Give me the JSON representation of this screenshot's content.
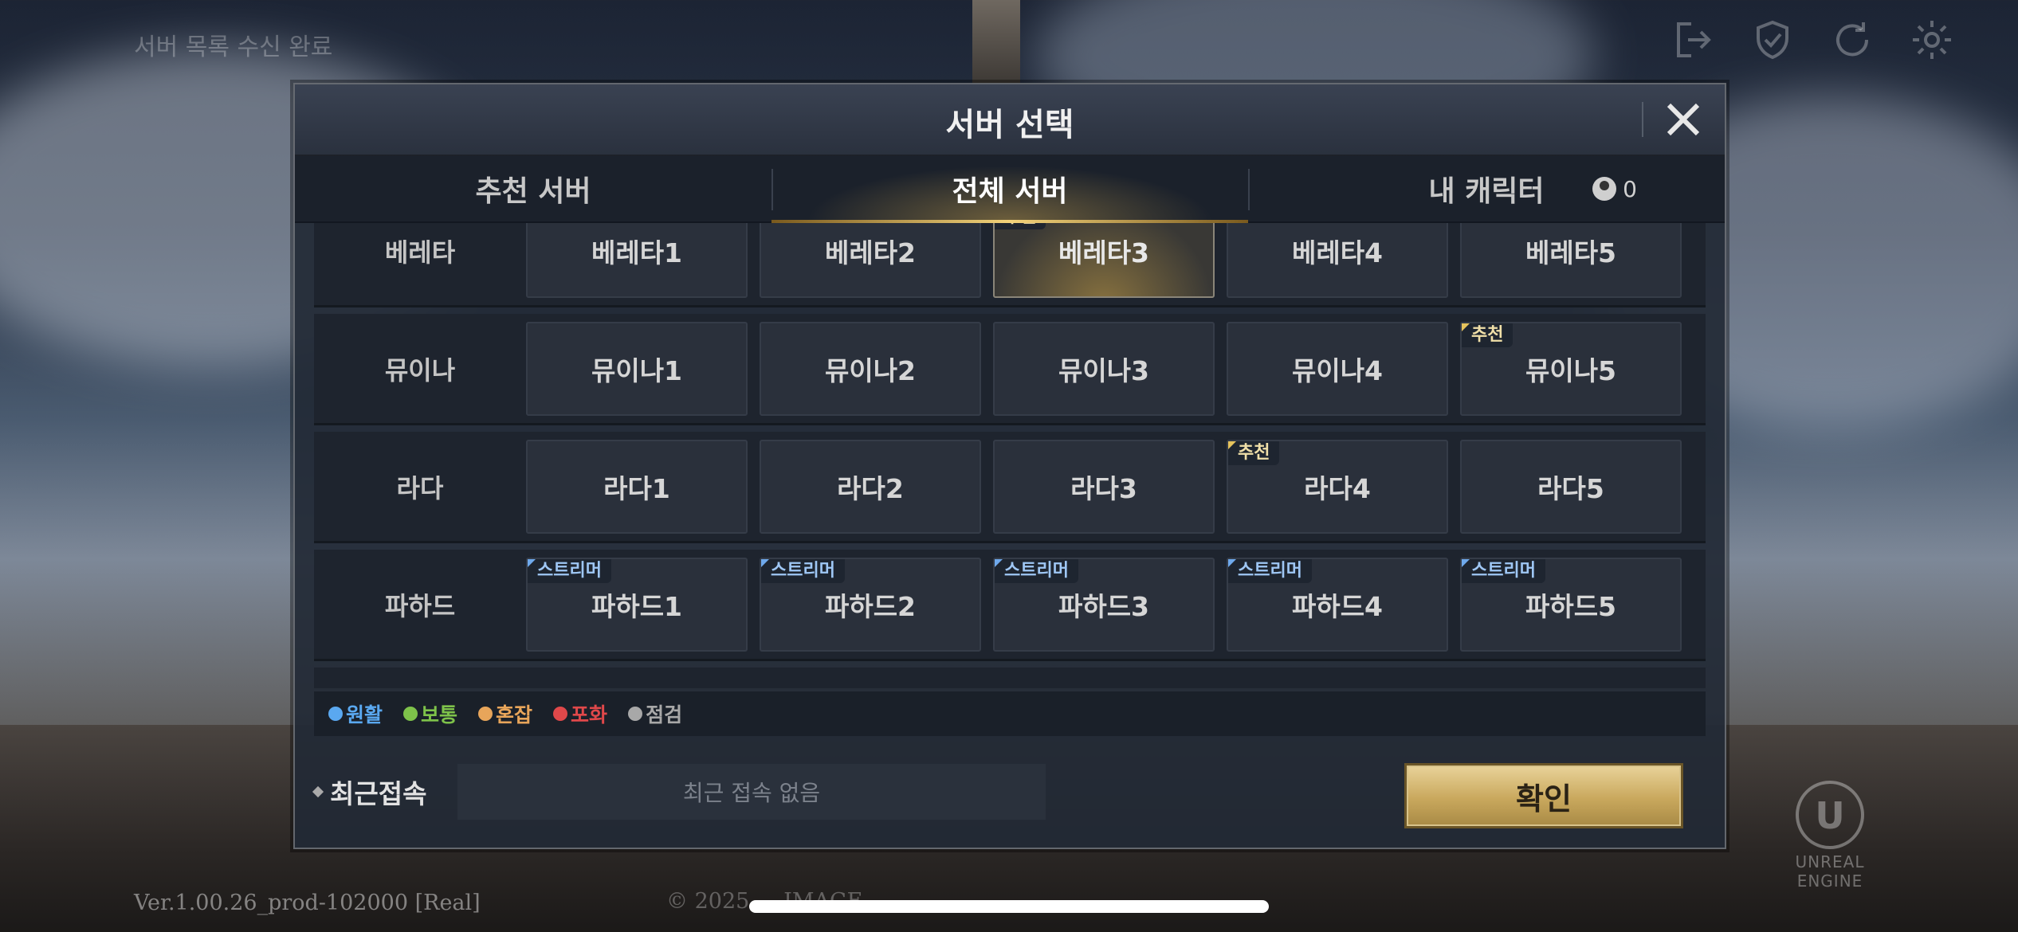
{
  "status_text": "서버 목록 수신 완료",
  "top_icons": [
    "logout-icon",
    "shield-check-icon",
    "refresh-icon",
    "settings-gear-icon"
  ],
  "modal": {
    "title": "서버 선택",
    "tabs": [
      {
        "label": "추천 서버",
        "active": false
      },
      {
        "label": "전체 서버",
        "active": true
      },
      {
        "label": "내 캐릭터",
        "active": false,
        "count": "0"
      }
    ]
  },
  "server_rows": [
    {
      "group": "베레타",
      "servers": [
        {
          "name": "베레타1",
          "badge": ""
        },
        {
          "name": "베레타2",
          "badge": ""
        },
        {
          "name": "베레타3",
          "badge": "추천",
          "selected": true
        },
        {
          "name": "베레타4",
          "badge": ""
        },
        {
          "name": "베레타5",
          "badge": ""
        }
      ]
    },
    {
      "group": "뮤이나",
      "servers": [
        {
          "name": "뮤이나1",
          "badge": ""
        },
        {
          "name": "뮤이나2",
          "badge": ""
        },
        {
          "name": "뮤이나3",
          "badge": ""
        },
        {
          "name": "뮤이나4",
          "badge": ""
        },
        {
          "name": "뮤이나5",
          "badge": "추천"
        }
      ]
    },
    {
      "group": "라다",
      "servers": [
        {
          "name": "라다1",
          "badge": ""
        },
        {
          "name": "라다2",
          "badge": ""
        },
        {
          "name": "라다3",
          "badge": ""
        },
        {
          "name": "라다4",
          "badge": "추천"
        },
        {
          "name": "라다5",
          "badge": ""
        }
      ]
    },
    {
      "group": "파하드",
      "servers": [
        {
          "name": "파하드1",
          "badge": "스트리머"
        },
        {
          "name": "파하드2",
          "badge": "스트리머"
        },
        {
          "name": "파하드3",
          "badge": "스트리머"
        },
        {
          "name": "파하드4",
          "badge": "스트리머"
        },
        {
          "name": "파하드5",
          "badge": "스트리머"
        }
      ]
    }
  ],
  "legend": [
    {
      "label": "원활",
      "color": "#5aa8f0"
    },
    {
      "label": "보통",
      "color": "#7ec24a"
    },
    {
      "label": "혼잡",
      "color": "#e8a55a"
    },
    {
      "label": "포화",
      "color": "#e0484a"
    },
    {
      "label": "점검",
      "color": "#a8a8a8"
    }
  ],
  "recent": {
    "label": "최근접속",
    "value": "최근 접속 없음"
  },
  "confirm_label": "확인",
  "version": "Ver.1.00.26_prod-102000 [Real]",
  "copyright": "© 2025 ... IMAGE.",
  "engine_logo_text": "UNREAL ENGINE"
}
